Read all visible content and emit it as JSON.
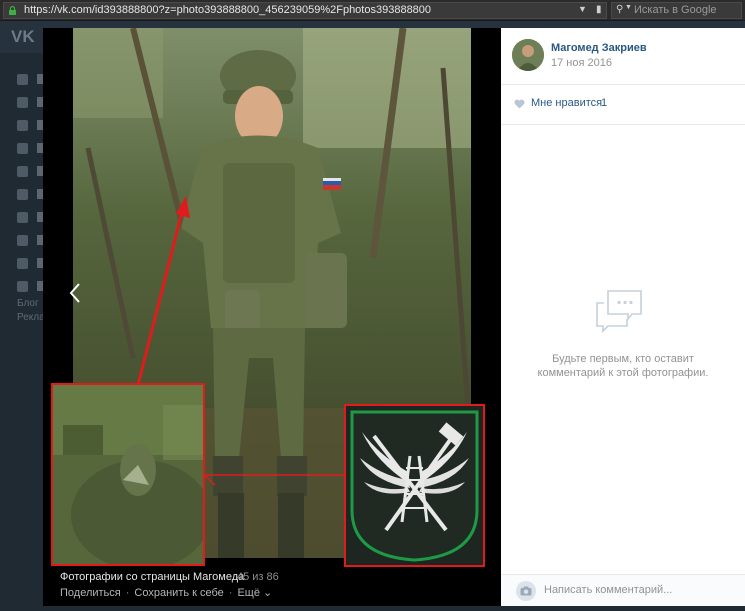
{
  "browser": {
    "url": "https://vk.com/id393888800?z=photo393888800_456239059%2Fphotos393888800",
    "search_placeholder": "Искать в Google"
  },
  "vk": {
    "logo": "VK",
    "footer": [
      "Блог",
      "Рекла"
    ]
  },
  "viewer": {
    "caption": "Фотографии со страницы Магомеда",
    "counter": "45 из 86",
    "actions": {
      "share": "Поделиться",
      "save": "Сохранить к себе",
      "more": "Ещё"
    }
  },
  "panel": {
    "author": "Магомед Закриев",
    "date": "17 ноя 2016",
    "like_label": "Мне нравится",
    "like_count": "1",
    "empty_comments": "Будьте первым, кто оставит комментарий к этой фотографии.",
    "comment_placeholder": "Написать комментарий..."
  },
  "icons": {
    "lock": "lock-icon",
    "heart": "heart-icon",
    "camera": "camera-icon",
    "comments": "comments-bubble-icon",
    "prev": "chevron-left-icon"
  },
  "colors": {
    "link": "#2a5885",
    "highlight_box": "#e11b1b",
    "patch_border": "#1e9a47"
  }
}
